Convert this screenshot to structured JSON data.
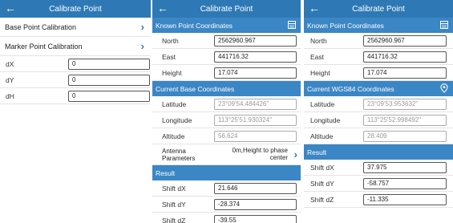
{
  "panel1": {
    "title": "Calibrate Point",
    "menu": [
      "Base Point Calibration",
      "Marker Point Calibration"
    ],
    "shifts": [
      {
        "label": "dX",
        "value": "0"
      },
      {
        "label": "dY",
        "value": "0"
      },
      {
        "label": "dH",
        "value": "0"
      }
    ]
  },
  "panel2": {
    "title": "Calibrate Point",
    "known_header": "Known Point Coordinates",
    "known": [
      {
        "label": "North",
        "value": "2562960.967"
      },
      {
        "label": "East",
        "value": "441716.32"
      },
      {
        "label": "Height",
        "value": "17.074"
      }
    ],
    "base_header": "Current Base Coordinates",
    "base": [
      {
        "label": "Latitude",
        "value": "23°09'54.484426\""
      },
      {
        "label": "Longitude",
        "value": "113°25'51.930324\""
      },
      {
        "label": "Altitude",
        "value": "56.624"
      }
    ],
    "antenna_label": "Antenna Parameters",
    "antenna_value": "0m,Height to phase center",
    "result_header": "Result",
    "result": [
      {
        "label": "Shift dX",
        "value": "21.646"
      },
      {
        "label": "Shift dY",
        "value": "-28.374"
      },
      {
        "label": "Shift dZ",
        "value": "-39.55"
      }
    ]
  },
  "panel3": {
    "title": "Calibrate Point",
    "known_header": "Known Point Coordinates",
    "known": [
      {
        "label": "North",
        "value": "2562960.967"
      },
      {
        "label": "East",
        "value": "441716.32"
      },
      {
        "label": "Height",
        "value": "17.074"
      }
    ],
    "wgs_header": "Current WGS84 Coordinates",
    "wgs": [
      {
        "label": "Latitude",
        "value": "23°09'53.953632\""
      },
      {
        "label": "Longitude",
        "value": "113°25'52.998492\""
      },
      {
        "label": "Altitude",
        "value": "28.409"
      }
    ],
    "result_header": "Result",
    "result": [
      {
        "label": "Shift dX",
        "value": "37.975"
      },
      {
        "label": "Shift dY",
        "value": "-58.757"
      },
      {
        "label": "Shift dZ",
        "value": "-11.335"
      }
    ]
  },
  "icons": {
    "back": "back-arrow-icon",
    "chevron": "chevron-right-icon",
    "list": "list-icon",
    "location": "location-pin-icon"
  },
  "colors": {
    "header": "#2e79b5",
    "section": "#3b86c4",
    "chevron": "#2e79b5"
  }
}
